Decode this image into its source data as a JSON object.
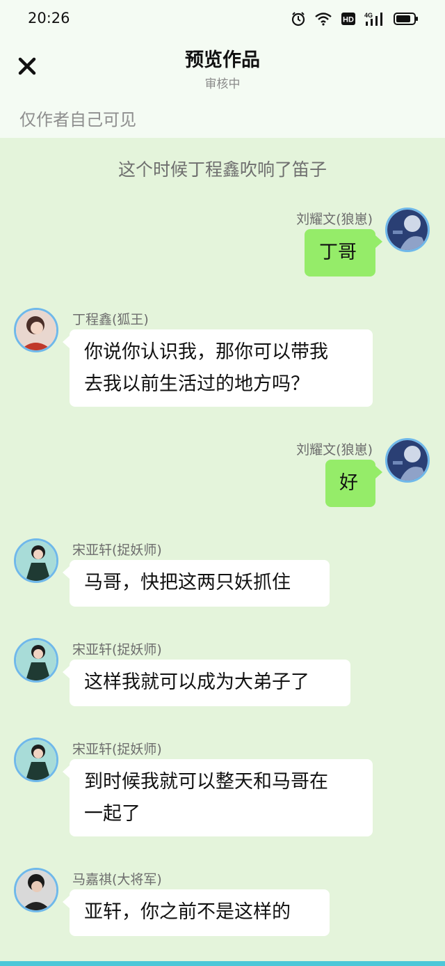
{
  "status_bar": {
    "time": "20:26",
    "icons": [
      "alarm-icon",
      "wifi-icon",
      "hd-icon",
      "4g-signal-icon",
      "battery-icon"
    ],
    "hd_label": "HD",
    "network_label": "4G"
  },
  "header": {
    "title": "预览作品",
    "subtitle": "审核中",
    "visibility_note": "仅作者自己可见",
    "close_icon": "close-icon"
  },
  "narration": "这个时候丁程鑫吹响了笛子",
  "messages": [
    {
      "side": "right",
      "name": "刘耀文(狼崽)",
      "text": "丁哥"
    },
    {
      "side": "left",
      "name": "丁程鑫(狐王)",
      "lines": [
        "你说你认识我，那你可以带我",
        "去我以前生活过的地方吗？"
      ]
    },
    {
      "side": "right",
      "name": "刘耀文(狼崽)",
      "text": "好"
    },
    {
      "side": "left",
      "name": "宋亚轩(捉妖师)",
      "text": "马哥，快把这两只妖抓住"
    },
    {
      "side": "left",
      "name": "宋亚轩(捉妖师)",
      "text": "这样我就可以成为大弟子了"
    },
    {
      "side": "left",
      "name": "宋亚轩(捉妖师)",
      "lines": [
        "到时候我就可以整天和马哥在",
        "一起了"
      ]
    },
    {
      "side": "left",
      "name": "马嘉祺(大将军)",
      "text": "亚轩，你之前不是这样的"
    }
  ],
  "colors": {
    "chat_background": "#E4F4DB",
    "header_background": "#F4FBF3",
    "outgoing_bubble": "#95EC69",
    "incoming_bubble": "#FFFFFF",
    "avatar_ring": "#6FB8EA"
  }
}
